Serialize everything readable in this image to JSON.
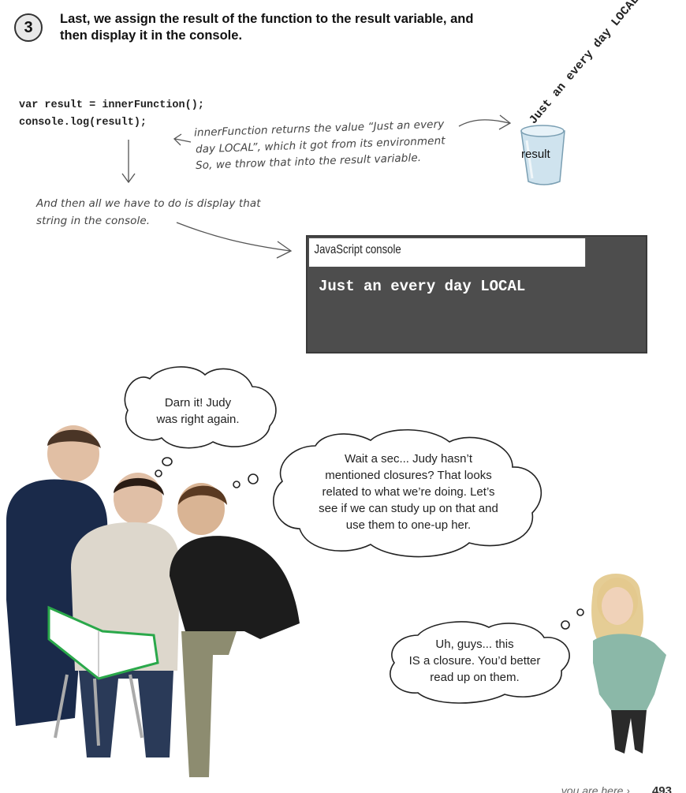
{
  "step": {
    "number": "3",
    "text": "Last, we assign the result of the function to the result variable, and then display it in the console."
  },
  "code": {
    "line1": "var result = innerFunction();",
    "line2": "console.log(result);"
  },
  "annotations": {
    "returns_line1": "innerFunction returns the value “Just an every",
    "returns_line2": "day LOCAL”, which it got from its environment",
    "returns_line3": "So, we throw that into the result variable.",
    "display_line1": "And then all we have to do is display that",
    "display_line2": "string in the console."
  },
  "variable": {
    "falling_string": "Just an every day LOCAL",
    "cup_label": "result"
  },
  "console": {
    "title": "JavaScript console",
    "output": "Just an every day LOCAL"
  },
  "bubbles": {
    "darn": [
      "Darn it! Judy",
      "was right again."
    ],
    "wait": [
      "Wait a sec... Judy hasn’t",
      "mentioned closures? That looks",
      "related to what we’re doing. Let’s",
      "see if we can study up on that and",
      "use them to one-up her."
    ],
    "judy": [
      "Uh, guys... this",
      "IS a closure. You’d better",
      "read up on them."
    ]
  },
  "footer": {
    "you_are_here": "you are here ›",
    "page": "493"
  },
  "icons": {
    "cup": "cup-icon",
    "people": "people-illustration",
    "judy": "woman-illustration"
  }
}
